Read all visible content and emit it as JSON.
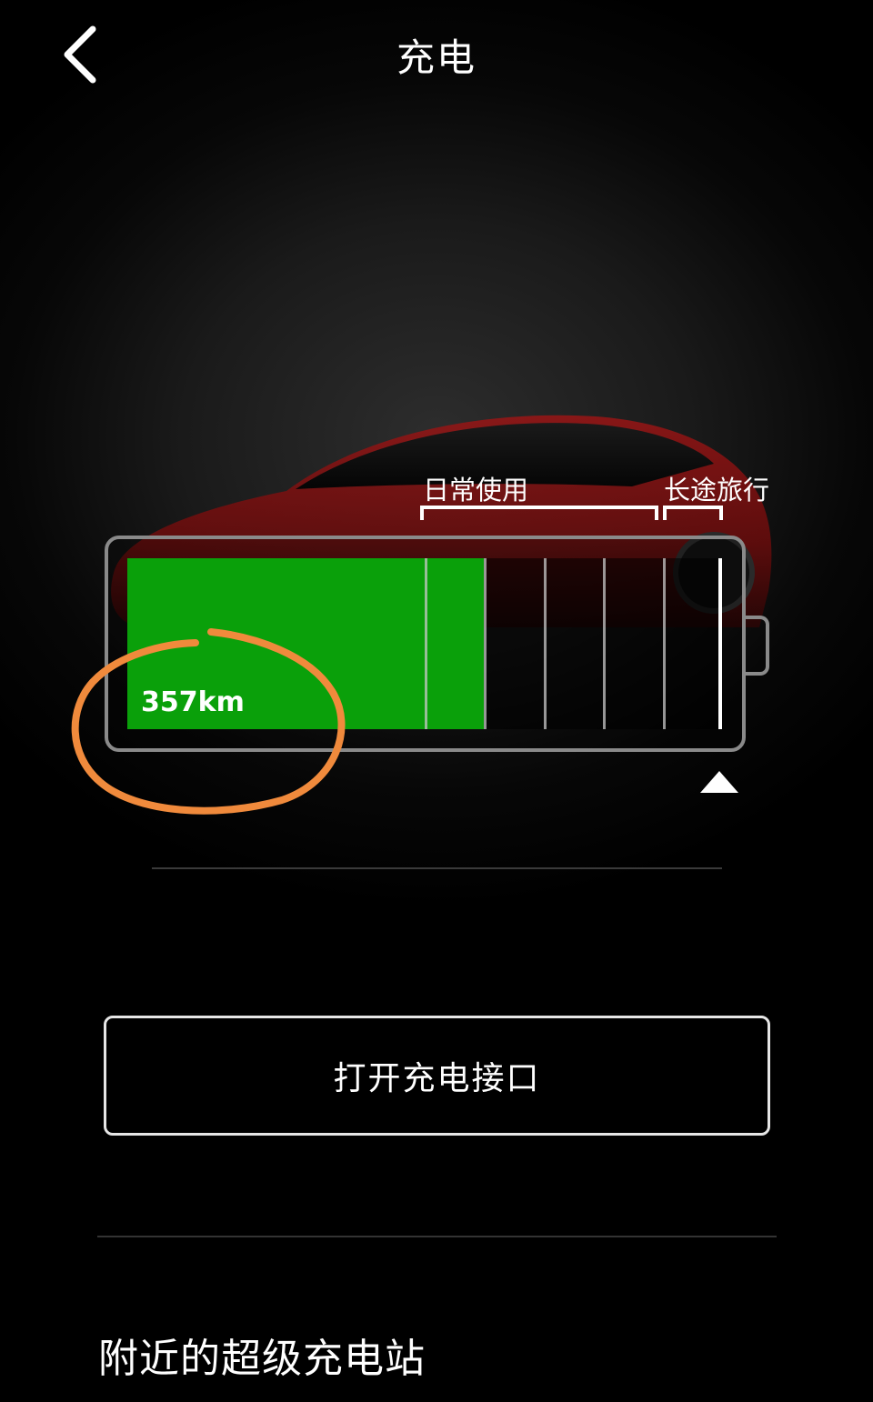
{
  "header": {
    "back_icon": "chevron-left-icon",
    "title": "充电"
  },
  "charge_limit": {
    "daily_label": "日常使用",
    "trip_label": "长途旅行",
    "range_label": "357km",
    "current_charge_fraction": 0.6,
    "charge_limit_fraction": 1.0,
    "segment_count": 10,
    "slider_icon": "triangle-up-icon"
  },
  "actions": {
    "open_charge_port_label": "打开充电接口"
  },
  "superchargers": {
    "section_title": "附近的超级充电站"
  },
  "colors": {
    "charge_fill": "#0aa00a",
    "annotation_circle": "#f08a3c",
    "car_body": "#8a1212"
  }
}
